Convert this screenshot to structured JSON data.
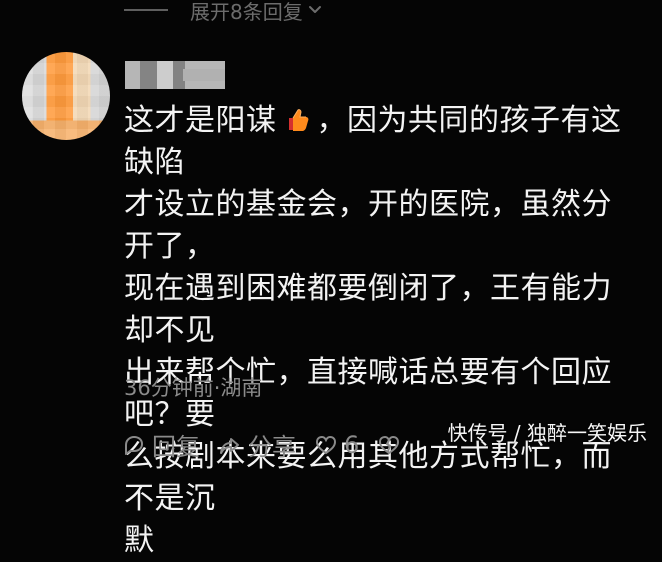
{
  "replies": {
    "expand_label": "展开8条回复"
  },
  "comment": {
    "text_before_emoji": "这才是阳谋",
    "text_after_emoji": "，因为共同的孩子有这缺陷\n才设立的基金会，开的医院，虽然分开了，\n现在遇到困难都要倒闭了，王有能力却不见\n出来帮个忙，直接喊话总要有个回应吧？要\n么按剧本来要么用其他方式帮忙，而不是沉\n默",
    "emoji": "thumbs-up-icon",
    "meta": "36分钟前·湖南"
  },
  "actions": {
    "reply_label": "回复",
    "share_label": "分享",
    "like_count": "6"
  },
  "watermark": "快传号 / 独醉一笑娱乐",
  "colors": {
    "background": "#050505",
    "primary_text": "#f3f3f3",
    "secondary_text": "#8b8b8b",
    "thumb_orange": "#ff8a1c"
  }
}
